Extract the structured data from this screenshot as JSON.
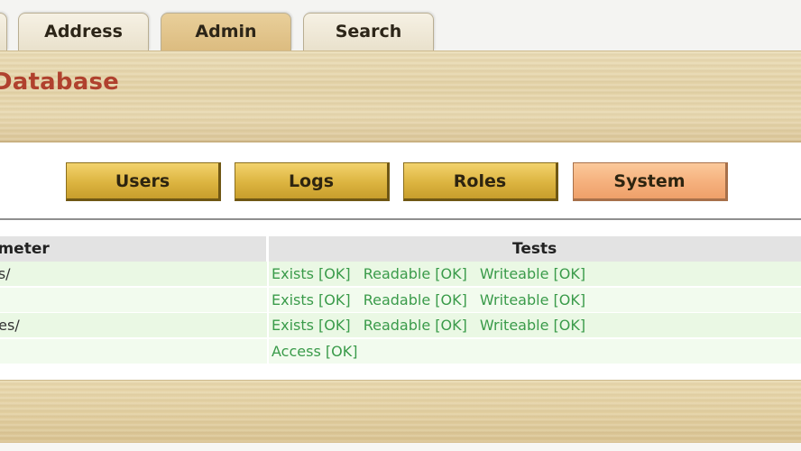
{
  "tabs": [
    {
      "label": "Address",
      "active": false
    },
    {
      "label": "Admin",
      "active": true
    },
    {
      "label": "Search",
      "active": false
    }
  ],
  "banner": {
    "title": "Database"
  },
  "subnav": {
    "items": [
      {
        "label": "Users",
        "active": false
      },
      {
        "label": "Logs",
        "active": false
      },
      {
        "label": "Roles",
        "active": false
      },
      {
        "label": "System",
        "active": true
      }
    ]
  },
  "table": {
    "headers": {
      "param": "ameter",
      "tests": "Tests"
    },
    "rows": [
      {
        "param": "es/",
        "tests": [
          "Exists [OK]",
          "Readable [OK]",
          "Writeable [OK]"
        ]
      },
      {
        "param": "",
        "tests": [
          "Exists [OK]",
          "Readable [OK]",
          "Writeable [OK]"
        ]
      },
      {
        "param": "ges/",
        "tests": [
          "Exists [OK]",
          "Readable [OK]",
          "Writeable [OK]"
        ]
      },
      {
        "param": "",
        "tests": [
          "Access [OK]"
        ]
      }
    ]
  },
  "colors": {
    "banner_title": "#b0412e",
    "ok_text": "#3a9b4a",
    "active_subnav": "#f5b07c",
    "subnav_button": "#dcb440"
  }
}
